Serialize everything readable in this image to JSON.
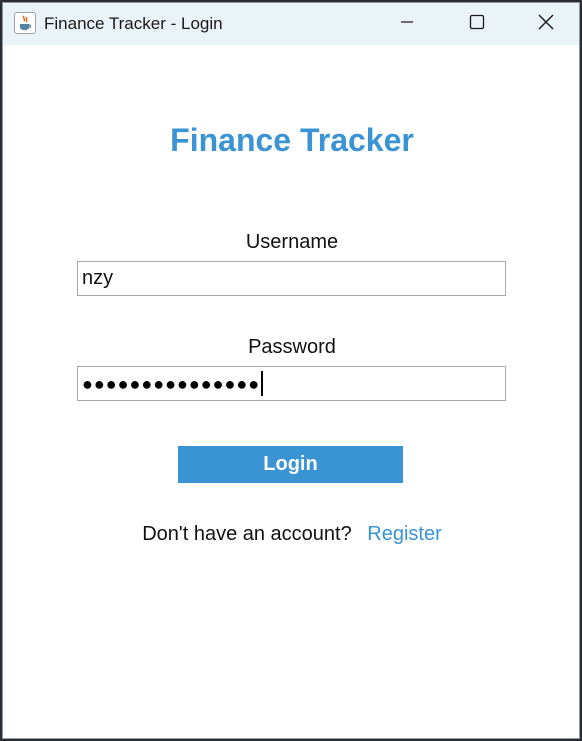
{
  "window": {
    "title": "Finance Tracker - Login",
    "controls": {
      "minimize_icon": "minimize-icon",
      "maximize_icon": "maximize-icon",
      "close_icon": "close-icon"
    }
  },
  "login": {
    "app_title": "Finance Tracker",
    "username": {
      "label": "Username",
      "value": "nzy"
    },
    "password": {
      "label": "Password",
      "masked_value": "●●●●●●●●●●●●●●●"
    },
    "login_button": "Login",
    "register_prompt": "Don't have an account?",
    "register_link": "Register"
  },
  "colors": {
    "accent": "#3a94d4",
    "titlebar": "#eaf3f7",
    "field_border": "#a9a9a9",
    "text": "#111111"
  }
}
